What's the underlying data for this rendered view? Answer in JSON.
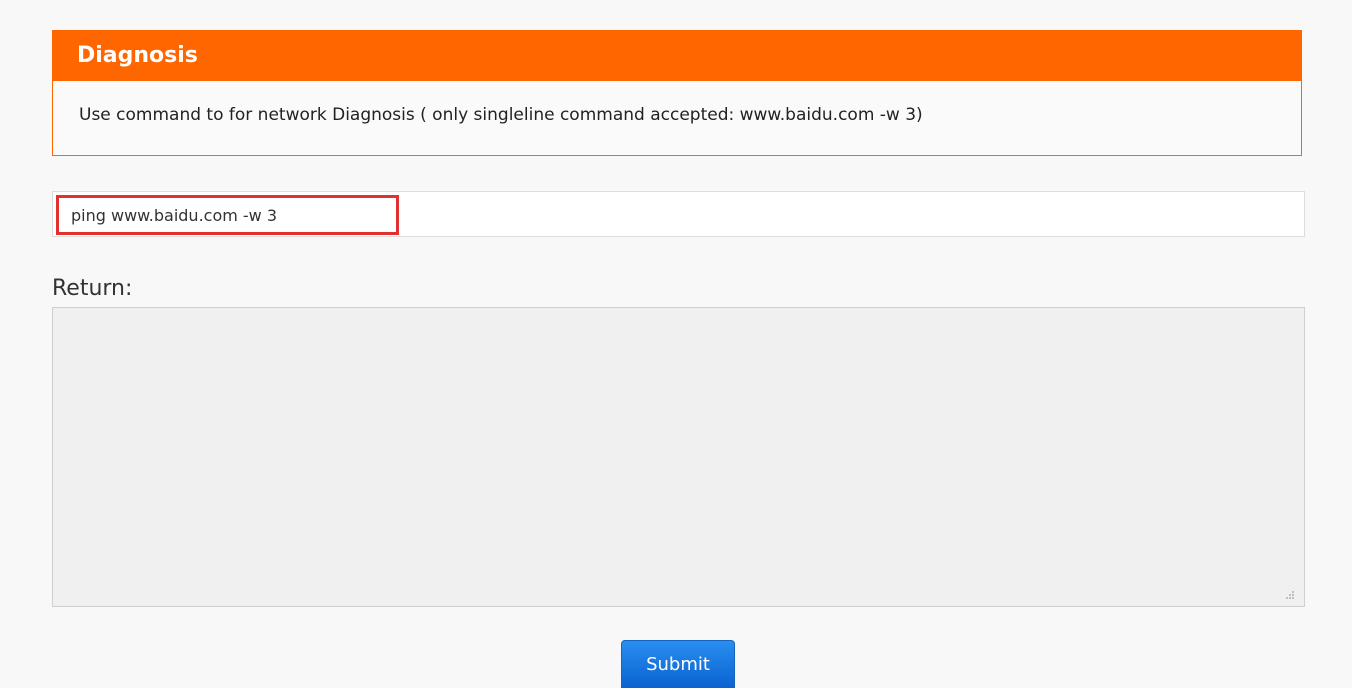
{
  "diagnosis": {
    "title": "Diagnosis",
    "description": "Use command to for network Diagnosis ( only singleline command accepted: www.baidu.com -w 3)"
  },
  "command": {
    "value": "ping www.baidu.com -w 3"
  },
  "result": {
    "label": "Return:",
    "value": ""
  },
  "actions": {
    "submit_label": "Submit"
  },
  "colors": {
    "header": "#ff6600",
    "highlight_border": "#e03030",
    "button": "#0a63d1"
  }
}
